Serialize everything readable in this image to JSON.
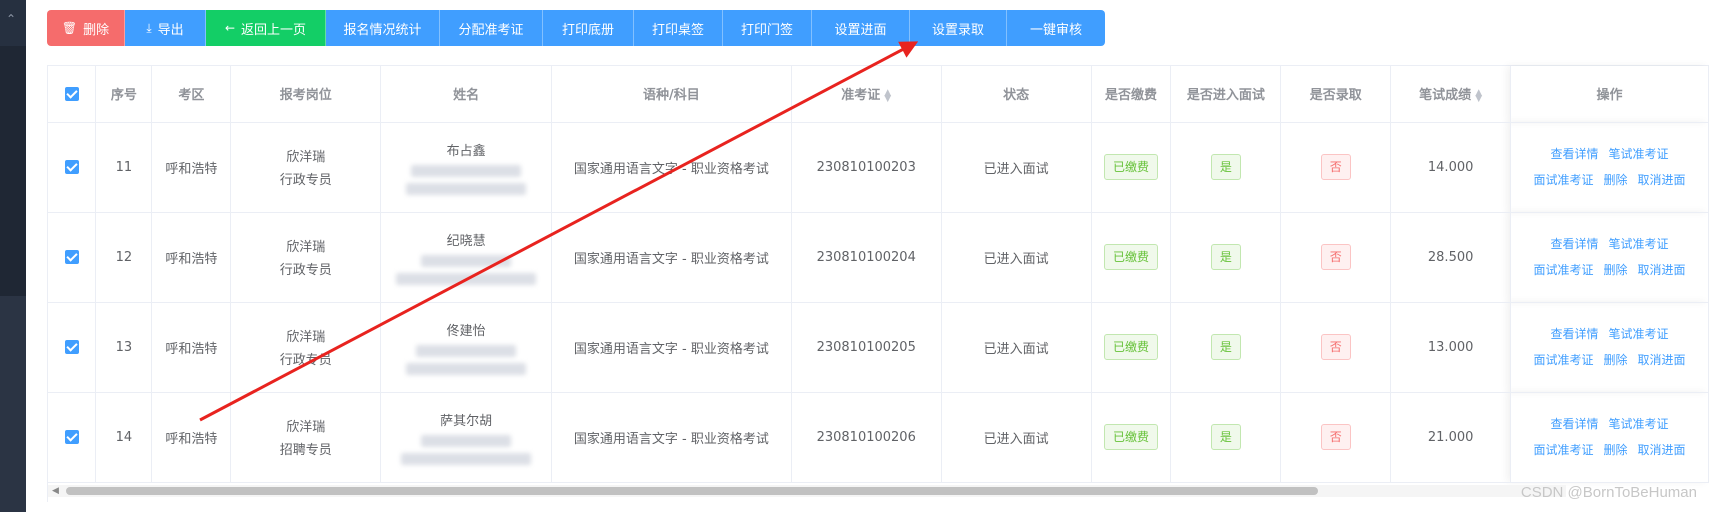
{
  "toolbar": {
    "delete": "删除",
    "export": "导出",
    "back": "返回上一页",
    "stats": "报名情况统计",
    "assign_ticket": "分配准考证",
    "print_roster": "打印底册",
    "print_desk": "打印桌签",
    "print_door": "打印门签",
    "set_interview": "设置进面",
    "set_admission": "设置录取",
    "one_click_review": "一键审核"
  },
  "table": {
    "headers": {
      "seq": "序号",
      "area": "考区",
      "position": "报考岗位",
      "name": "姓名",
      "subject": "语种/科目",
      "ticket": "准考证",
      "status": "状态",
      "paid": "是否缴费",
      "interview": "是否进入面试",
      "admitted": "是否录取",
      "score": "笔试成绩",
      "ops": "操作"
    },
    "ops": {
      "view": "查看详情",
      "written_ticket": "笔试准考证",
      "interview_ticket": "面试准考证",
      "delete": "删除",
      "cancel_interview": "取消进面"
    },
    "rows": [
      {
        "seq": "11",
        "area": "呼和浩特",
        "company": "欣洋瑞",
        "job": "行政专员",
        "name": "布占鑫",
        "subject": "国家通用语言文字 - 职业资格考试",
        "ticket": "230810100203",
        "status": "已进入面试",
        "paid": "已缴费",
        "interview": "是",
        "admitted": "否",
        "score": "14.000"
      },
      {
        "seq": "12",
        "area": "呼和浩特",
        "company": "欣洋瑞",
        "job": "行政专员",
        "name": "纪晓慧",
        "subject": "国家通用语言文字 - 职业资格考试",
        "ticket": "230810100204",
        "status": "已进入面试",
        "paid": "已缴费",
        "interview": "是",
        "admitted": "否",
        "score": "28.500"
      },
      {
        "seq": "13",
        "area": "呼和浩特",
        "company": "欣洋瑞",
        "job": "行政专员",
        "name": "佟建怡",
        "subject": "国家通用语言文字 - 职业资格考试",
        "ticket": "230810100205",
        "status": "已进入面试",
        "paid": "已缴费",
        "interview": "是",
        "admitted": "否",
        "score": "13.000"
      },
      {
        "seq": "14",
        "area": "呼和浩特",
        "company": "欣洋瑞",
        "job": "招聘专员",
        "name": "萨其尔胡",
        "subject": "国家通用语言文字 - 职业资格考试",
        "ticket": "230810100206",
        "status": "已进入面试",
        "paid": "已缴费",
        "interview": "是",
        "admitted": "否",
        "score": "21.000"
      }
    ]
  },
  "watermark": "CSDN @BornToBeHuman",
  "colors": {
    "primary": "#409eff",
    "danger": "#f56c6c",
    "success": "#13ce66",
    "annotation": "#e8231f"
  }
}
